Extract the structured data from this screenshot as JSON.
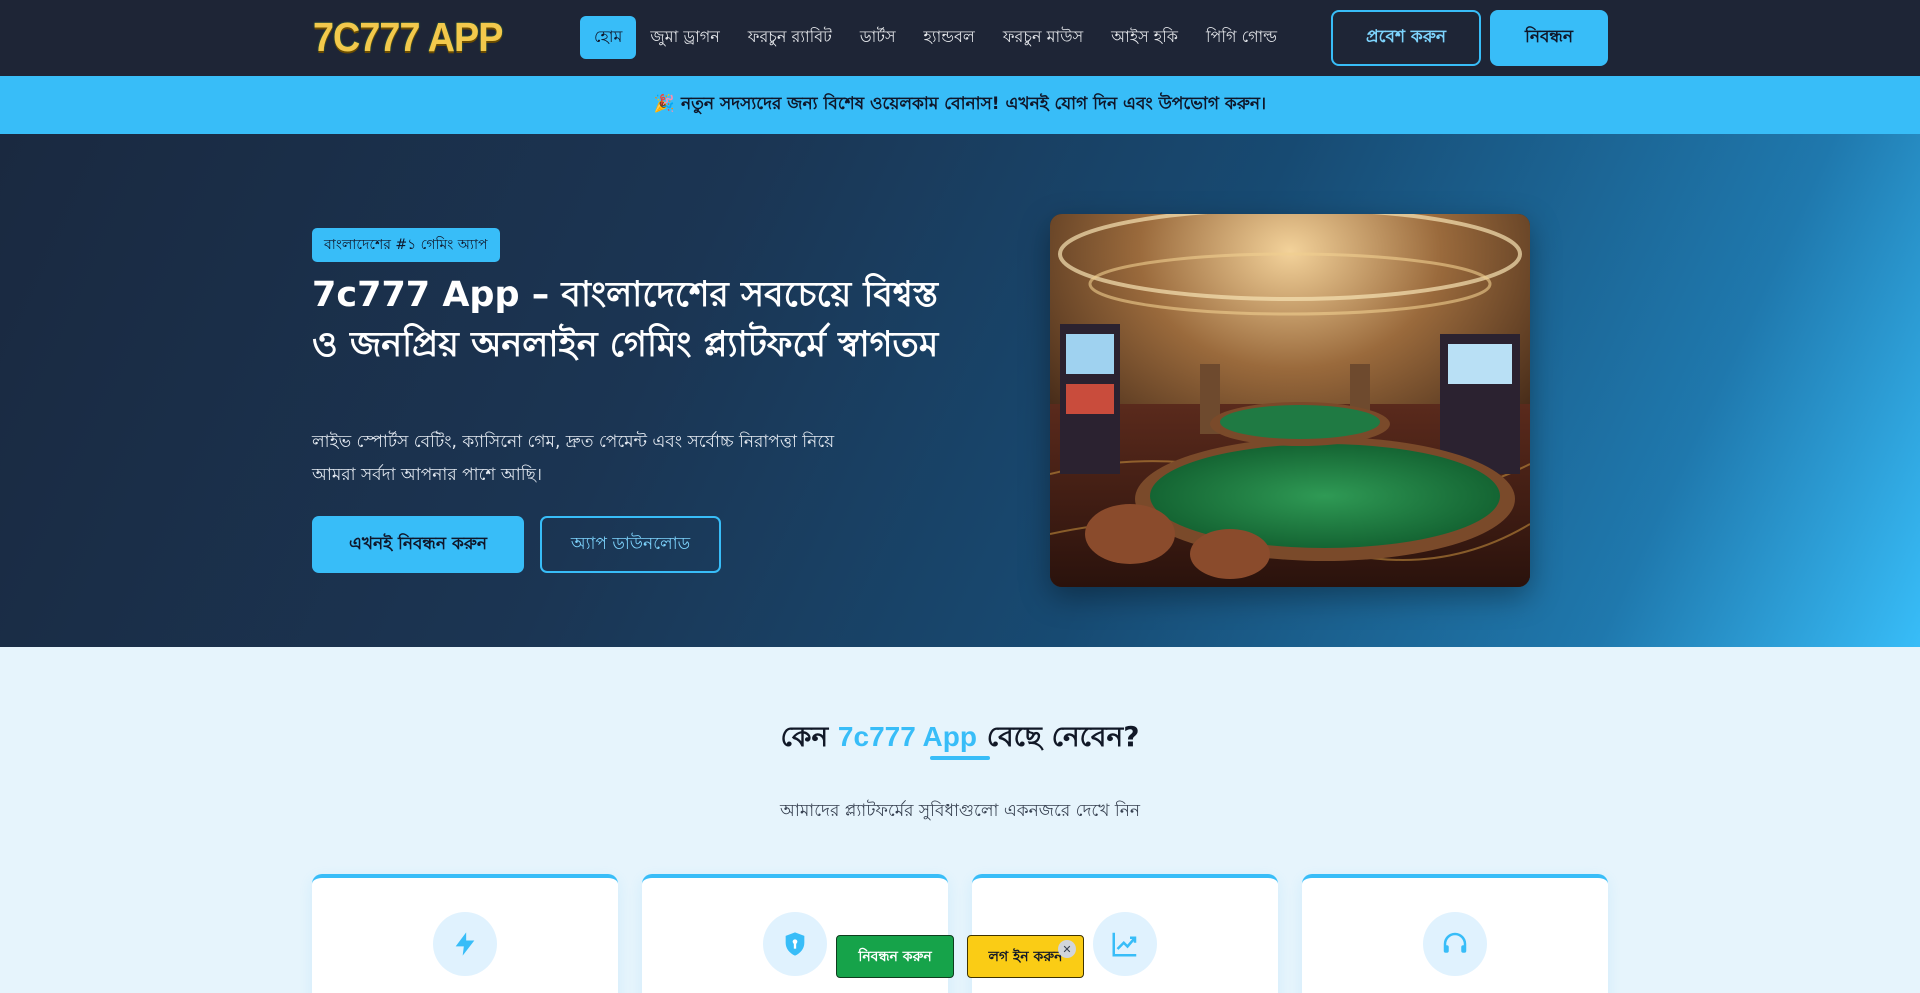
{
  "header": {
    "logo": "7C777 APP",
    "nav": [
      {
        "label": "হোম",
        "active": true
      },
      {
        "label": "জুমা ড্রাগন",
        "active": false
      },
      {
        "label": "ফরচুন র‍্যাবিট",
        "active": false
      },
      {
        "label": "ডার্টস",
        "active": false
      },
      {
        "label": "হ্যান্ডবল",
        "active": false
      },
      {
        "label": "ফরচুন মাউস",
        "active": false
      },
      {
        "label": "আইস হকি",
        "active": false
      },
      {
        "label": "পিগি গোল্ড",
        "active": false
      }
    ],
    "login_label": "প্রবেশ করুন",
    "register_label": "নিবন্ধন"
  },
  "announcement": "🎉 নতুন সদস্যদের জন্য বিশেষ ওয়েলকাম বোনাস! এখনই যোগ দিন এবং উপভোগ করুন।",
  "hero": {
    "badge": "বাংলাদেশের #১ গেমিং অ্যাপ",
    "title": "7c777 App – বাংলাদেশের সবচেয়ে বিশ্বস্ত ও জনপ্রিয় অনলাইন গেমিং প্ল্যাটফর্মে স্বাগতম",
    "description": "লাইভ স্পোর্টস বেটিং, ক্যাসিনো গেম, দ্রুত পেমেন্ট এবং সর্বোচ্চ নিরাপত্তা নিয়ে আমরা সর্বদা আপনার পাশে আছি।",
    "cta_primary": "এখনই নিবন্ধন করুন",
    "cta_secondary": "অ্যাপ ডাউনলোড"
  },
  "why": {
    "title_before": "কেন",
    "title_accent": "7c777 App",
    "title_after": "বেছে নেবেন?",
    "subtitle": "আমাদের প্ল্যাটফর্মের সুবিধাগুলো একনজরে দেখে নিন",
    "cards": [
      {
        "icon": "lightning-icon"
      },
      {
        "icon": "shield-icon"
      },
      {
        "icon": "chart-line-icon"
      },
      {
        "icon": "headset-icon"
      }
    ]
  },
  "floating": {
    "register_label": "নিবন্ধন করুন",
    "login_label": "লগ ইন করুন",
    "close_glyph": "✕"
  },
  "colors": {
    "header_bg": "#1e2536",
    "accent": "#38bdf8",
    "page_bg": "#e6f4fc",
    "float_register": "#16a34a",
    "float_login": "#facc15"
  }
}
